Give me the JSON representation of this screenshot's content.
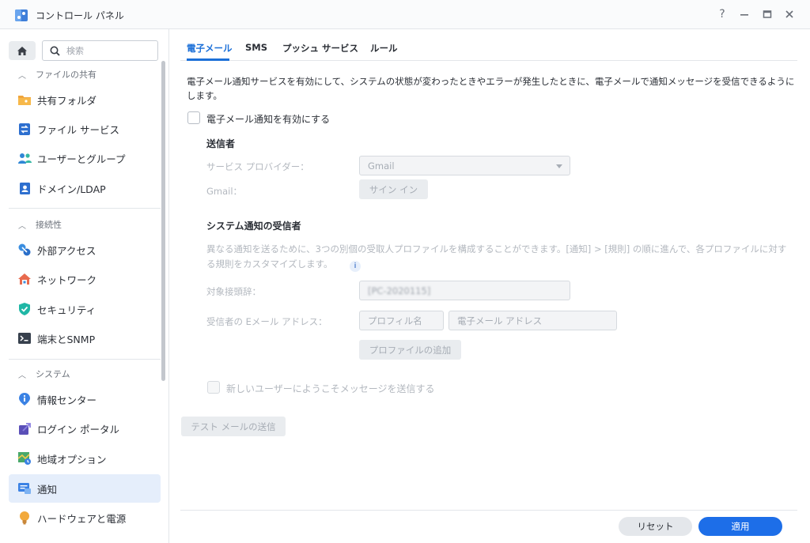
{
  "window": {
    "title": "コントロール パネル",
    "help": "?"
  },
  "sidebar": {
    "search_placeholder": "検索",
    "groups": [
      {
        "label": "ファイルの共有"
      },
      {
        "label": "接続性"
      },
      {
        "label": "システム"
      }
    ],
    "items": [
      {
        "label": "共有フォルダ",
        "icon": "shared-folder-icon"
      },
      {
        "label": "ファイル サービス",
        "icon": "file-services-icon"
      },
      {
        "label": "ユーザーとグループ",
        "icon": "users-groups-icon"
      },
      {
        "label": "ドメイン/LDAP",
        "icon": "domain-ldap-icon"
      },
      {
        "label": "外部アクセス",
        "icon": "external-access-icon"
      },
      {
        "label": "ネットワーク",
        "icon": "network-icon"
      },
      {
        "label": "セキュリティ",
        "icon": "security-shield-icon"
      },
      {
        "label": "端末とSNMP",
        "icon": "terminal-icon"
      },
      {
        "label": "情報センター",
        "icon": "info-center-icon"
      },
      {
        "label": "ログイン ポータル",
        "icon": "login-portal-icon"
      },
      {
        "label": "地域オプション",
        "icon": "regional-options-icon"
      },
      {
        "label": "通知",
        "icon": "notification-icon",
        "active": true
      },
      {
        "label": "ハードウェアと電源",
        "icon": "hardware-power-icon"
      }
    ]
  },
  "tabs": [
    {
      "label": "電子メール",
      "active": true
    },
    {
      "label": "SMS"
    },
    {
      "label": "プッシュ サービス"
    },
    {
      "label": "ルール"
    }
  ],
  "email": {
    "description": "電子メール通知サービスを有効にして、システムの状態が変わったときやエラーが発生したときに、電子メールで通知メッセージを受信できるようにします。",
    "enable_label": "電子メール通知を有効にする",
    "sender": {
      "title": "送信者",
      "provider_label": "サービス プロバイダー：",
      "provider_value": "Gmail",
      "gmail_label": "Gmail：",
      "sign_in_label": "サイン イン"
    },
    "recipients": {
      "title": "システム通知の受信者",
      "description": "異なる通知を送るために、3つの別個の受取人プロファイルを構成することができます。[通知] > [規則] の順に進んで、各プロファイルに対する規則をカスタマイズします。",
      "info_glyph": "i",
      "subject_prefix_label": "対象接頭辞：",
      "subject_prefix_value": "[PC-2020115]",
      "email_label": "受信者の Eメール アドレス：",
      "profile_name_placeholder": "プロフィル名",
      "email_placeholder": "電子メール アドレス",
      "add_profile_label": "プロファイルの追加"
    },
    "welcome_label": "新しいユーザーにようこそメッセージを送信する",
    "test_label": "テスト メールの送信"
  },
  "footer": {
    "reset_label": "リセット",
    "apply_label": "適用"
  },
  "colors": {
    "accent": "#1d6ee8",
    "active_bg": "#e5eefb"
  }
}
